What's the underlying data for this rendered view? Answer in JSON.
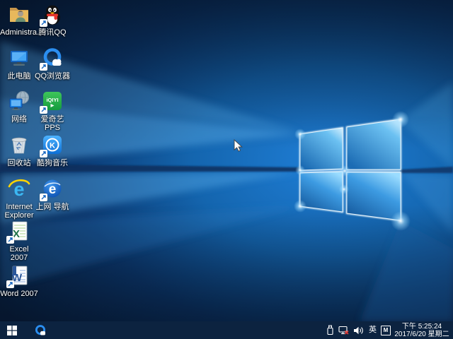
{
  "desktop": {
    "icons": [
      {
        "name": "user-folder",
        "label": "Administra..."
      },
      {
        "name": "tencent-qq",
        "label": "腾讯QQ"
      },
      {
        "name": "this-pc",
        "label": "此电脑"
      },
      {
        "name": "qq-browser",
        "label": "QQ浏览器"
      },
      {
        "name": "network",
        "label": "网络"
      },
      {
        "name": "iqiyi-pps",
        "label": "爱奇艺PPS",
        "glyph": "iQIYI"
      },
      {
        "name": "recycle-bin",
        "label": "回收站"
      },
      {
        "name": "kugou-music",
        "label": "酷狗音乐",
        "glyph": "K"
      },
      {
        "name": "internet-explorer",
        "label": "Internet Explorer",
        "glyph": "e"
      },
      {
        "name": "web-navigation",
        "label": "上网 导航",
        "glyph": "e"
      },
      {
        "name": "excel-2007",
        "label": "Excel 2007",
        "glyph": "X"
      },
      {
        "name": "word-2007",
        "label": "Word 2007",
        "glyph": "W"
      }
    ]
  },
  "taskbar": {
    "tray": {
      "input_indicator": "英",
      "ime_badge": "M",
      "time": "下午 5:25:24",
      "date": "2017/6/20 星期二"
    }
  },
  "colors": {
    "taskbar_bg": "#0c2340",
    "wallpaper_accent": "#1f7ed6",
    "iqiyi_green": "#29b64e",
    "kugou_blue": "#1a8ce8",
    "qq_scarf_red": "#e6362d",
    "ie_blue": "#3bb7f2",
    "word_blue": "#2b579a",
    "excel_green": "#1e7145",
    "tray_error_red": "#e53935"
  }
}
